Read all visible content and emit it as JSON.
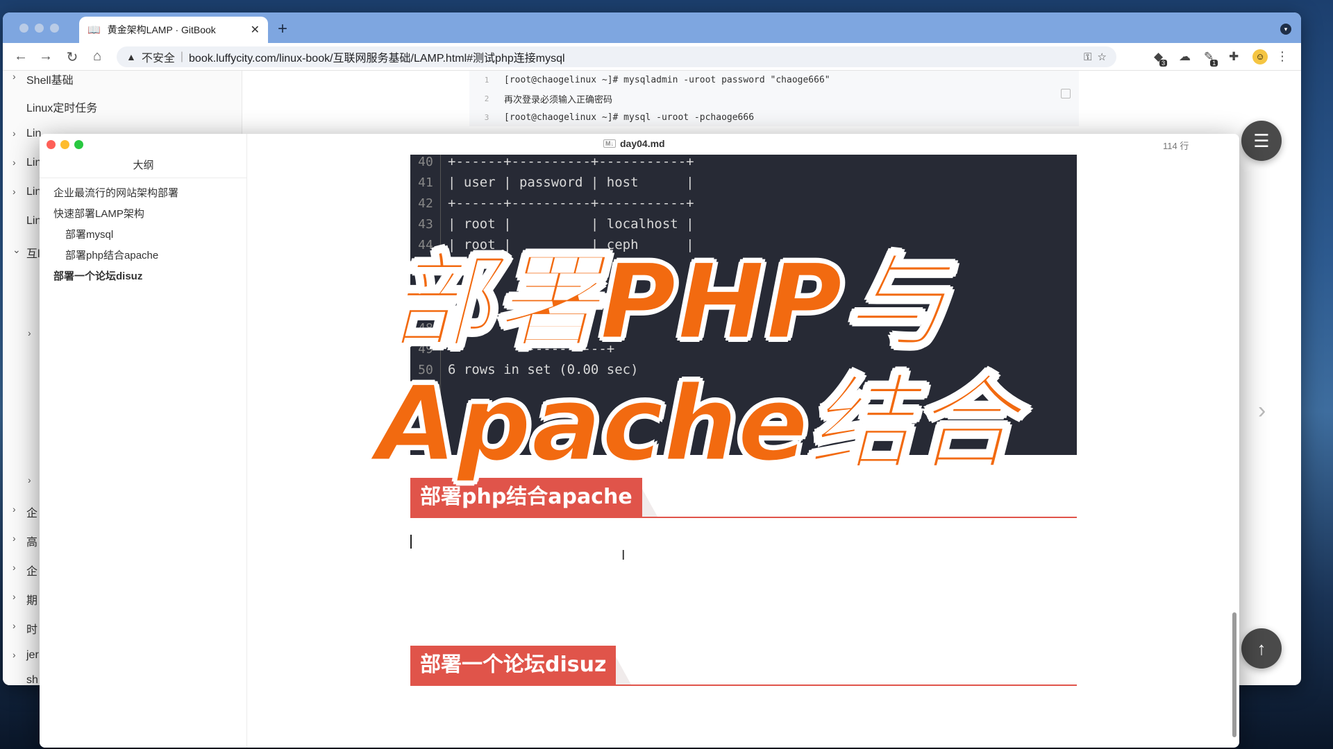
{
  "browser": {
    "tab_title": "黄金架构LAMP · GitBook",
    "tab_close": "✕",
    "new_tab": "+",
    "insecure_label": "不安全",
    "url": "book.luffycity.com/linux-book/互联网服务基础/LAMP.html#测试php连接mysql",
    "extension_badges": [
      "3",
      "1"
    ]
  },
  "gitbook": {
    "sidebar_items": [
      {
        "label": "Shell基础",
        "chevron": true
      },
      {
        "label": "Linux定时任务",
        "chevron": false
      },
      {
        "label": "Lin",
        "chevron": true
      },
      {
        "label": "Lin",
        "chevron": true
      },
      {
        "label": "Lin",
        "chevron": true
      },
      {
        "label": "Lin",
        "chevron": false
      },
      {
        "label": "互l",
        "chevron": true
      }
    ],
    "sidebar_bottom_items": [
      "企",
      "高",
      "企",
      "期",
      "时",
      "jer",
      "sh"
    ],
    "code_lines": [
      {
        "n": "1",
        "text": "[root@chaogelinux ~]# mysqladmin -uroot password \"chaoge666\""
      },
      {
        "n": "2",
        "text": "再次登录必须输入正确密码"
      },
      {
        "n": "3",
        "text": "[root@chaogelinux ~]# mysql -uroot -pchaoge666"
      }
    ]
  },
  "typora": {
    "filename": "day04.md",
    "line_count": "114 行",
    "outline_title": "大纲",
    "outline_items": [
      {
        "label": "企业最流行的网站架构部署",
        "level": 1,
        "active": false
      },
      {
        "label": "快速部署LAMP架构",
        "level": 1,
        "active": false
      },
      {
        "label": "部署mysql",
        "level": 2,
        "active": false
      },
      {
        "label": "部署php结合apache",
        "level": 2,
        "active": false
      },
      {
        "label": "部署一个论坛disuz",
        "level": 1,
        "active": true
      }
    ],
    "terminal_lines": [
      {
        "n": "40",
        "text": "+------+----------+-----------+"
      },
      {
        "n": "41",
        "text": "| user | password | host      |"
      },
      {
        "n": "42",
        "text": "+------+----------+-----------+"
      },
      {
        "n": "43",
        "text": "| root |          | localhost |"
      },
      {
        "n": "44",
        "text": "| root |          | ceph      |"
      },
      {
        "n": "45",
        "text": ""
      },
      {
        "n": "46",
        "text": ""
      },
      {
        "n": "47",
        "text": ""
      },
      {
        "n": "48",
        "text": ""
      },
      {
        "n": "49",
        "text": "         -----------+"
      },
      {
        "n": "50",
        "text": "6 rows in set (0.00 sec)"
      }
    ],
    "heading_1": "部署php结合apache",
    "heading_2": "部署一个论坛disuz"
  },
  "overlay": {
    "line1": "部署PHP与",
    "line2": "Apache结合"
  }
}
